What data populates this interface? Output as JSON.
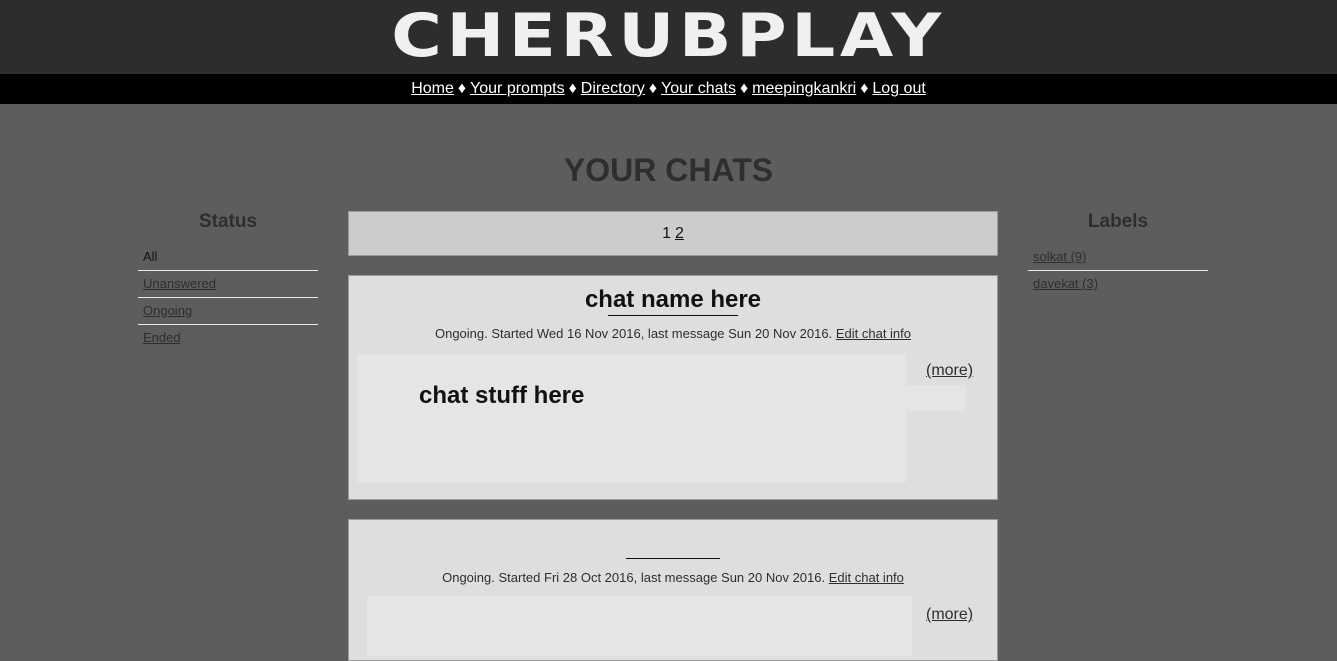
{
  "header": {
    "logo_text": "CHERUBPLAY"
  },
  "nav": {
    "items": [
      {
        "label": "Home"
      },
      {
        "label": "Your prompts"
      },
      {
        "label": "Directory"
      },
      {
        "label": "Your chats"
      },
      {
        "label": "meepingkankri"
      },
      {
        "label": "Log out"
      }
    ],
    "separator": "♦"
  },
  "main": {
    "title": "YOUR CHATS"
  },
  "status": {
    "heading": "Status",
    "items": [
      {
        "label": "All",
        "active": true
      },
      {
        "label": "Unanswered"
      },
      {
        "label": "Ongoing"
      },
      {
        "label": "Ended"
      }
    ]
  },
  "labels": {
    "heading": "Labels",
    "items": [
      {
        "label": "solkat (9)"
      },
      {
        "label": "davekat (3)"
      }
    ]
  },
  "pager": {
    "current": "1",
    "next": "2"
  },
  "chats": [
    {
      "title": "chat name here",
      "meta": "Ongoing. Started Wed 16 Nov 2016, last message Sun 20 Nov 2016.",
      "edit_label": "Edit chat info",
      "preview": "chat stuff here",
      "more_label": "(more)"
    },
    {
      "title": "",
      "meta": "Ongoing. Started Fri 28 Oct 2016, last message Sun 20 Nov 2016.",
      "edit_label": "Edit chat info",
      "preview": "",
      "more_label": "(more)"
    }
  ]
}
